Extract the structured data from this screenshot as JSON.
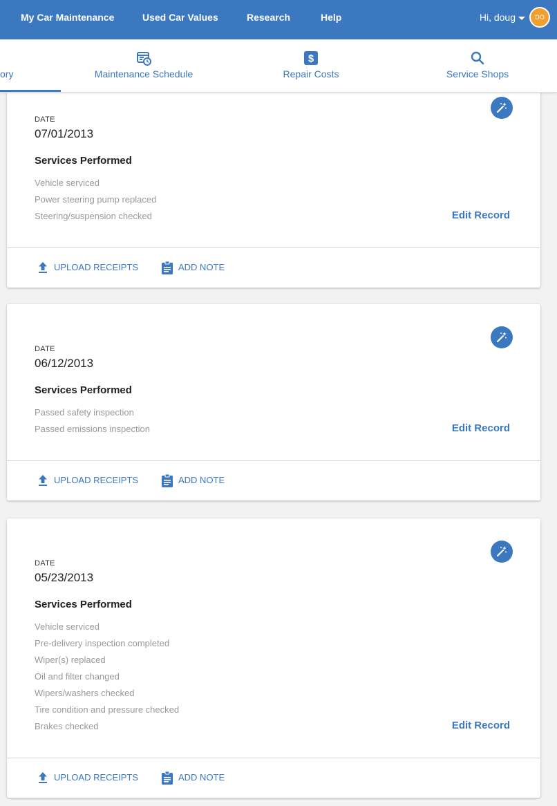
{
  "topnav": {
    "links": [
      "My Car Maintenance",
      "Used Car Values",
      "Research",
      "Help"
    ],
    "greeting": "Hi, doug",
    "avatar_initials": "DO",
    "bg_color": "#3b78bf",
    "avatar_color": "#f0a030"
  },
  "tabs": [
    {
      "label": "ory",
      "icon": "history-icon",
      "active": true
    },
    {
      "label": "Maintenance Schedule",
      "icon": "calendar-clock-icon"
    },
    {
      "label": "Repair Costs",
      "icon": "dollar-icon"
    },
    {
      "label": "Service Shops",
      "icon": "search-icon"
    }
  ],
  "records": [
    {
      "date_label": "DATE",
      "date": "07/01/2013",
      "services_title": "Services Performed",
      "services": [
        "Vehicle serviced",
        "Power steering pump replaced",
        "Steering/suspension checked"
      ],
      "edit_label": "Edit Record",
      "upload_label": "UPLOAD RECEIPTS",
      "note_label": "ADD NOTE"
    },
    {
      "date_label": "DATE",
      "date": "06/12/2013",
      "services_title": "Services Performed",
      "services": [
        "Passed safety inspection",
        "Passed emissions inspection"
      ],
      "edit_label": "Edit Record",
      "upload_label": "UPLOAD RECEIPTS",
      "note_label": "ADD NOTE"
    },
    {
      "date_label": "DATE",
      "date": "05/23/2013",
      "services_title": "Services Performed",
      "services": [
        "Vehicle serviced",
        "Pre-delivery inspection completed",
        "Wiper(s) replaced",
        "Oil and filter changed",
        "Wipers/washers checked",
        "Tire condition and pressure checked",
        "Brakes checked"
      ],
      "edit_label": "Edit Record",
      "upload_label": "UPLOAD RECEIPTS",
      "note_label": "ADD NOTE"
    }
  ]
}
